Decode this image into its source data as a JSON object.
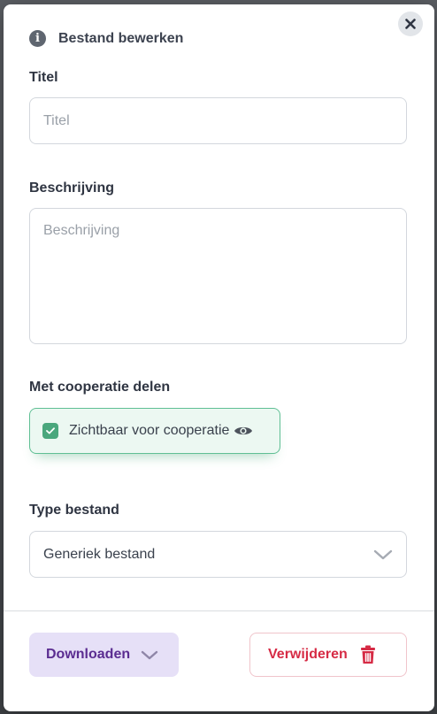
{
  "modal": {
    "title": "Bestand bewerken",
    "close_icon": "close-icon",
    "info_icon": "info-icon"
  },
  "fields": {
    "title_label": "Titel",
    "title_placeholder": "Titel",
    "title_value": "",
    "description_label": "Beschrijving",
    "description_placeholder": "Beschrijving",
    "description_value": ""
  },
  "share": {
    "label": "Met cooperatie delen",
    "checkbox_label": "Zichtbaar voor cooperatie",
    "checked": true,
    "icon": "eye-icon"
  },
  "file_type": {
    "label": "Type bestand",
    "selected": "Generiek bestand"
  },
  "footer": {
    "download_label": "Downloaden",
    "delete_label": "Verwijderen"
  },
  "colors": {
    "accent_purple": "#5b2d91",
    "danger_red": "#d62b45",
    "success_green": "#4aa77d"
  }
}
